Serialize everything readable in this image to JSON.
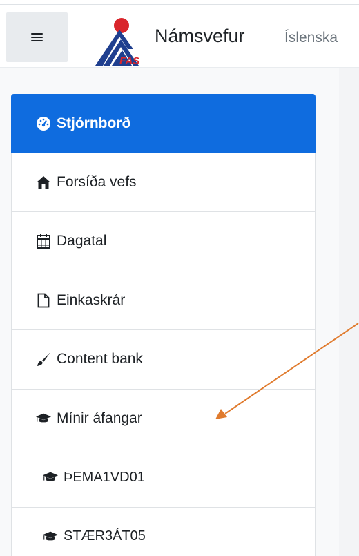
{
  "header": {
    "menu_button": "menu",
    "logo_text": "FAS",
    "site_name": "Námsvefur",
    "language": "Íslenska"
  },
  "sidebar": {
    "items": [
      {
        "label": "Stjórnborð",
        "icon": "dashboard-icon",
        "active": true
      },
      {
        "label": "Forsíða vefs",
        "icon": "home-icon"
      },
      {
        "label": "Dagatal",
        "icon": "calendar-icon"
      },
      {
        "label": "Einkaskrár",
        "icon": "file-icon"
      },
      {
        "label": "Content bank",
        "icon": "paintbrush-icon"
      },
      {
        "label": "Mínir áfangar",
        "icon": "graduation-cap-icon"
      },
      {
        "label": "ÞEMA1VD01",
        "icon": "graduation-cap-icon"
      },
      {
        "label": "STÆR3ÁT05",
        "icon": "graduation-cap-icon"
      }
    ]
  },
  "annotation": {
    "arrow_color": "#e07b2e"
  },
  "colors": {
    "accent": "#0f6cdf",
    "logo_red": "#d9262c",
    "logo_blue": "#1f3f8f"
  }
}
